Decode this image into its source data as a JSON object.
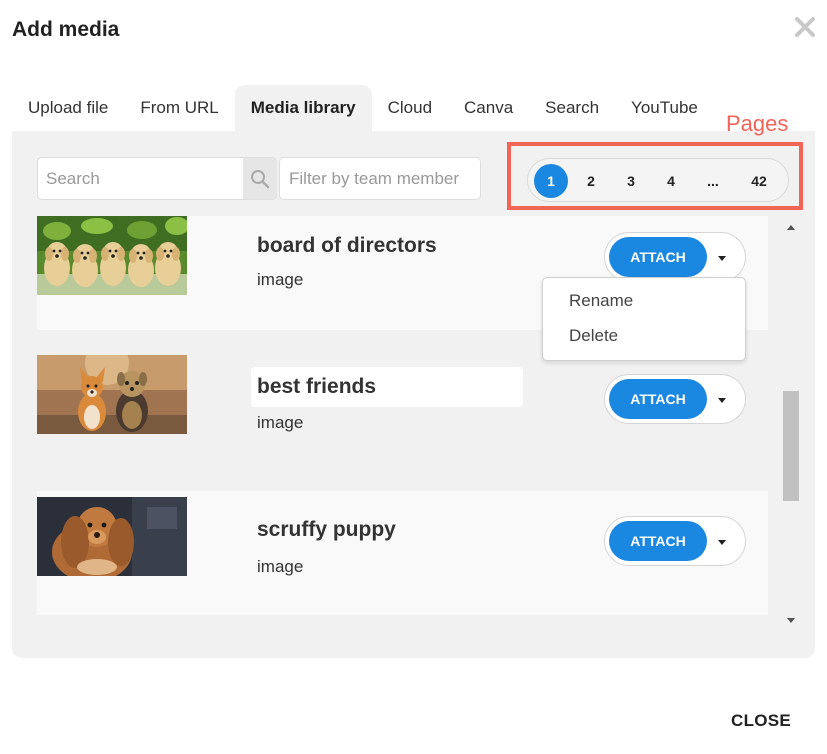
{
  "dialog": {
    "title": "Add media",
    "close_label": "CLOSE"
  },
  "tabs": [
    {
      "label": "Upload file",
      "active": false
    },
    {
      "label": "From URL",
      "active": false
    },
    {
      "label": "Media library",
      "active": true
    },
    {
      "label": "Cloud",
      "active": false
    },
    {
      "label": "Canva",
      "active": false
    },
    {
      "label": "Search",
      "active": false
    },
    {
      "label": "YouTube",
      "active": false
    }
  ],
  "search": {
    "placeholder": "Search",
    "value": ""
  },
  "filter": {
    "placeholder": "Filter by team member",
    "value": ""
  },
  "pagination": {
    "pages": [
      "1",
      "2",
      "3",
      "4",
      "...",
      "42"
    ],
    "current": "1"
  },
  "annotation": {
    "label": "Pages",
    "color": "#f0645a"
  },
  "media_items": [
    {
      "name": "board of directors",
      "type": "image",
      "attach_label": "ATTACH",
      "thumbnail": "golden-retriever-puppies-photo"
    },
    {
      "name": "best friends",
      "type": "image",
      "attach_label": "ATTACH",
      "thumbnail": "corgi-and-yorkie-photo"
    },
    {
      "name": "scruffy puppy",
      "type": "image",
      "attach_label": "ATTACH",
      "thumbnail": "cocker-spaniel-photo"
    }
  ],
  "attach_menu": {
    "items": [
      "Rename",
      "Delete"
    ]
  },
  "colors": {
    "accent": "#1a87e0",
    "panel": "#f1f1f1",
    "highlight": "#f0645a"
  },
  "icons": {
    "close": "close-icon",
    "search": "search-icon",
    "dropdown": "chevron-down-icon"
  }
}
